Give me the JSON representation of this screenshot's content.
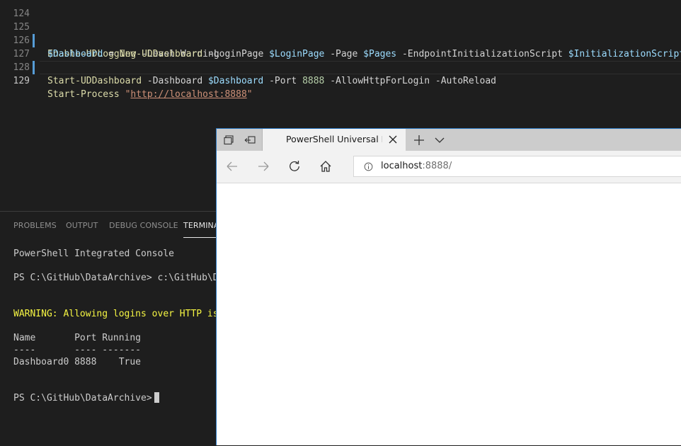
{
  "editor": {
    "lines": [
      {
        "num": "124"
      },
      {
        "num": "125",
        "tokens": [
          "Enable-UDLogging",
          " -Level",
          " Warning"
        ]
      },
      {
        "num": "126",
        "tokens": [
          "$Dashboard",
          " = ",
          "New-UDDashboard",
          " -LoginPage ",
          "$LoginPage",
          " -Page ",
          "$Pages",
          " -EndpointInitializationScript ",
          "$InitializationScript",
          " -"
        ]
      },
      {
        "num": "127",
        "tokens": [
          "Start-UDDashboard",
          " -Dashboard ",
          "$Dashboard",
          " -Port ",
          "8888",
          " -AllowHttpForLogin -AutoReload"
        ]
      },
      {
        "num": "128"
      },
      {
        "num": "129",
        "tokens": [
          "Start-Process",
          " \"",
          "http://localhost:8888",
          "\""
        ]
      }
    ]
  },
  "panel": {
    "tabs": [
      "PROBLEMS",
      "OUTPUT",
      "DEBUG CONSOLE",
      "TERMINA"
    ],
    "active_tab": "TERMINA",
    "terminal": {
      "title": "PowerShell Integrated Console",
      "line1": "PS C:\\GitHub\\DataArchive> c:\\GitHub\\DataA",
      "warning": "WARNING: Allowing logins over HTTP is ins",
      "header": "Name       Port Running",
      "separator": "----       ---- -------",
      "row": "Dashboard0 8888    True",
      "prompt": "PS C:\\GitHub\\DataArchive>"
    }
  },
  "browser": {
    "tab_title": "PowerShell Universal Da",
    "url_host": "localhost",
    "url_rest": ":8888/"
  },
  "colors": {
    "editor_bg": "#1e1e1e",
    "keyword": "#dcdcaa",
    "variable": "#9cdcfe",
    "number": "#b5cea8",
    "string": "#ce9178",
    "warning": "#f5f543",
    "accent": "#2b78c2"
  }
}
